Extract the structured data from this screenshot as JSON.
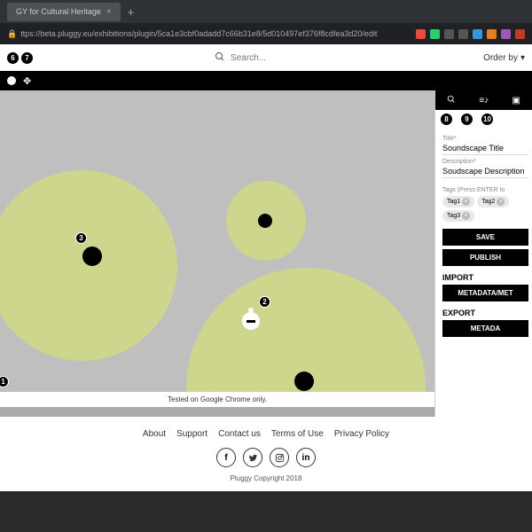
{
  "browser": {
    "tab_title": "GY for Cultural Heritage",
    "url": "ttps://beta.pluggy.eu/exhibitions/plugin/5ca1e3cbf0adadd7c66b31e8/5d010497ef376f8cdfea3d20/edit"
  },
  "header": {
    "badges": [
      "6",
      "7"
    ],
    "search_placeholder": "Search...",
    "order_by": "Order by"
  },
  "canvas": {
    "badges": {
      "top_left": "1",
      "obj2": "2",
      "obj3": "3"
    },
    "note": "Tested on Google Chrome only."
  },
  "panel": {
    "badges": [
      "8",
      "9",
      "10"
    ],
    "title_label": "Title*",
    "title_value": "Soundscape Title",
    "desc_label": "Description*",
    "desc_value": "Soudscape Description",
    "tags_label": "Tags (Press ENTER to",
    "tags": [
      "Tag1",
      "Tag2",
      "Tag3"
    ],
    "save": "SAVE",
    "publish": "PUBLISH",
    "import": "IMPORT",
    "import_btn": "METADATA/MET",
    "export": "EXPORT",
    "export_btn": "METADA"
  },
  "footer": {
    "links": [
      "About",
      "Support",
      "Contact us",
      "Terms of Use",
      "Privacy Policy"
    ],
    "copyright": "Pluggy Copyright 2018"
  }
}
